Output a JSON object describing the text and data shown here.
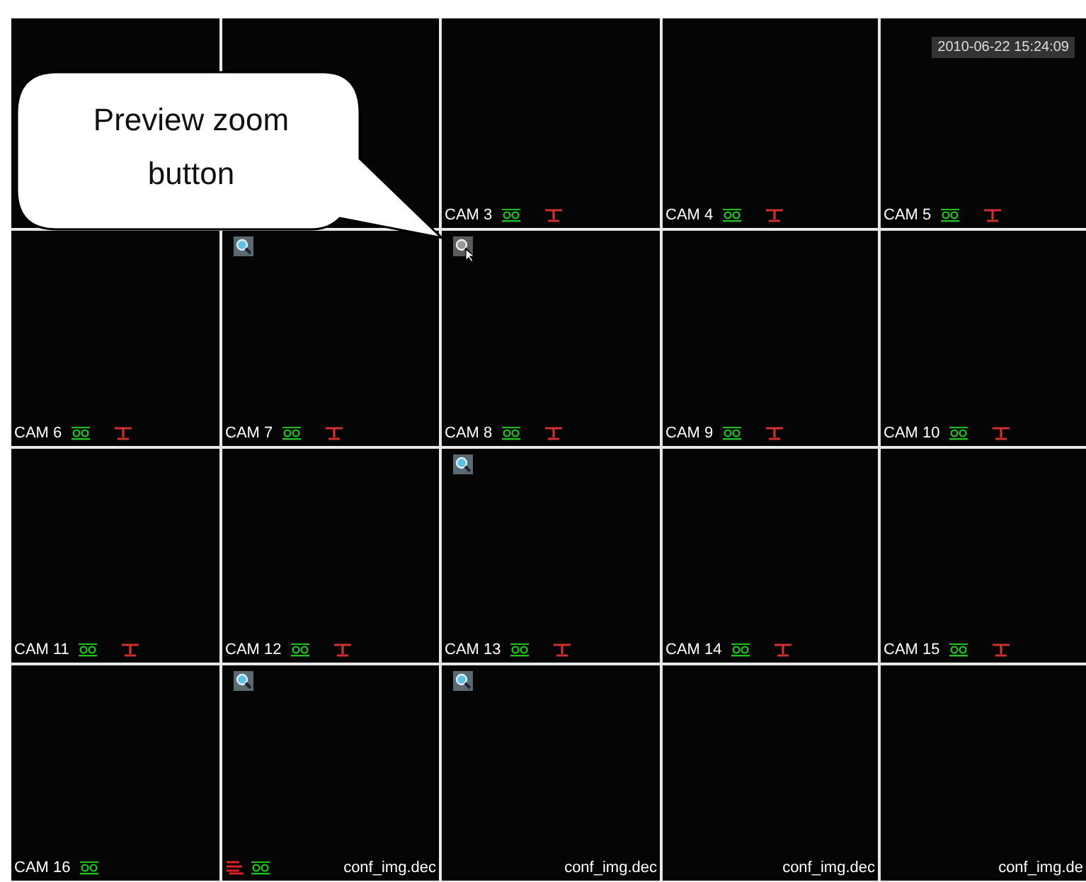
{
  "callout": {
    "text": "Preview zoom button"
  },
  "timestamp": "2010-06-22 15:24:09",
  "cells": [
    {
      "zoom": false,
      "hovered": false
    },
    {
      "zoom": false,
      "hovered": false
    },
    {
      "label": "CAM 3",
      "rec": true,
      "motion": true,
      "alarm": false,
      "zoom": false,
      "hovered": false
    },
    {
      "label": "CAM 4",
      "rec": true,
      "motion": true,
      "alarm": false,
      "zoom": false,
      "hovered": false
    },
    {
      "label": "CAM 5",
      "rec": true,
      "motion": true,
      "alarm": false,
      "zoom": false,
      "hovered": false,
      "timestamp": true
    },
    {
      "label": "CAM 6",
      "rec": true,
      "motion": true,
      "alarm": false,
      "zoom": false,
      "hovered": false
    },
    {
      "label": "CAM 7",
      "rec": true,
      "motion": true,
      "alarm": false,
      "zoom": true,
      "hovered": false
    },
    {
      "label": "CAM 8",
      "rec": true,
      "motion": true,
      "alarm": false,
      "zoom": true,
      "hovered": true
    },
    {
      "label": "CAM 9",
      "rec": true,
      "motion": true,
      "alarm": false,
      "zoom": false,
      "hovered": false
    },
    {
      "label": "CAM 10",
      "rec": true,
      "motion": true,
      "alarm": false,
      "zoom": false,
      "hovered": false
    },
    {
      "label": "CAM 11",
      "rec": true,
      "motion": true,
      "alarm": false,
      "zoom": false,
      "hovered": false
    },
    {
      "label": "CAM 12",
      "rec": true,
      "motion": true,
      "alarm": false,
      "zoom": false,
      "hovered": false
    },
    {
      "label": "CAM 13",
      "rec": true,
      "motion": true,
      "alarm": false,
      "zoom": true,
      "hovered": false
    },
    {
      "label": "CAM 14",
      "rec": true,
      "motion": true,
      "alarm": false,
      "zoom": false,
      "hovered": false
    },
    {
      "label": "CAM 15",
      "rec": true,
      "motion": true,
      "alarm": false,
      "zoom": false,
      "hovered": false
    },
    {
      "label": "CAM 16",
      "rec": true,
      "motion": false,
      "alarm": false,
      "zoom": false,
      "hovered": false
    },
    {
      "rec": true,
      "motion": false,
      "alarm": true,
      "zoom": true,
      "hovered": false,
      "file": "conf_img.dec"
    },
    {
      "rec": false,
      "motion": false,
      "alarm": false,
      "zoom": true,
      "hovered": false,
      "file": "conf_img.dec"
    },
    {
      "rec": false,
      "motion": false,
      "alarm": false,
      "zoom": false,
      "hovered": false,
      "file": "conf_img.dec"
    },
    {
      "rec": false,
      "motion": false,
      "alarm": false,
      "zoom": false,
      "hovered": false,
      "file": "conf_img.de"
    }
  ]
}
